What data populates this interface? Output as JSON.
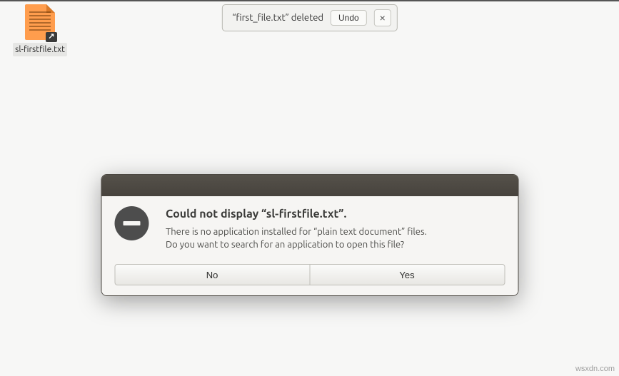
{
  "desktop": {
    "file_label": "sl-firstfile.txt"
  },
  "toast": {
    "message": "“first_file.txt” deleted",
    "undo_label": "Undo",
    "close_label": "×"
  },
  "dialog": {
    "title": "Could not display “sl-firstfile.txt”.",
    "line1": "There is no application installed for “plain text document” files.",
    "line2": "Do you want to search for an application to open this file?",
    "no_label": "No",
    "yes_label": "Yes"
  },
  "watermark": "wsxdn.com"
}
